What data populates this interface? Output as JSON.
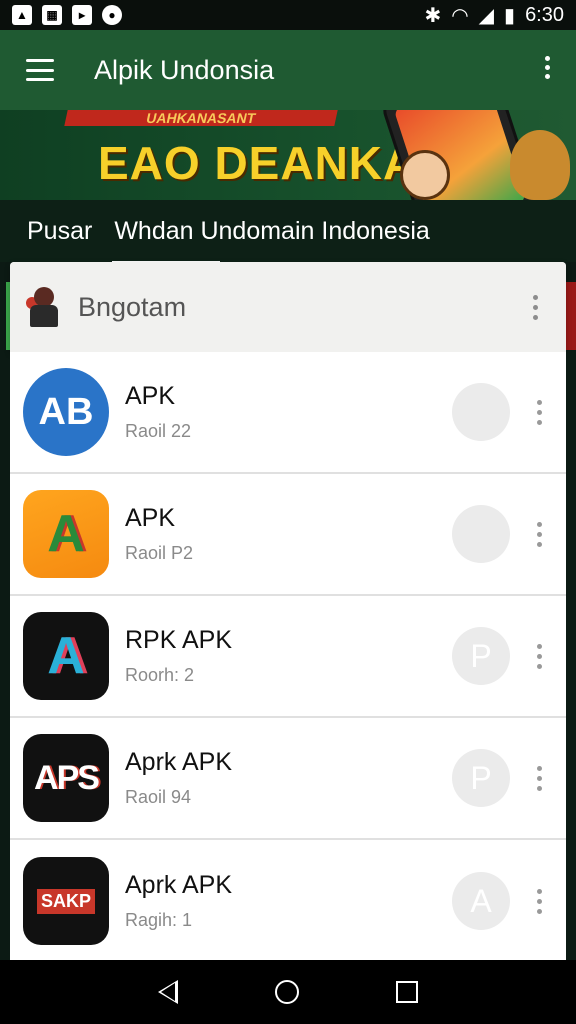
{
  "status_bar": {
    "time": "6:30",
    "left_icons": [
      "notification-icon",
      "gallery-icon",
      "play-icon",
      "circle-icon"
    ],
    "right_icons": [
      "bluetooth-icon",
      "wifi-icon",
      "signal-icon",
      "battery-icon"
    ]
  },
  "app_bar": {
    "title": "Alpik Undonsia"
  },
  "banner": {
    "ribbon_text": "UAHKANASANT",
    "headline": "EAO DEANKA"
  },
  "tabs": [
    {
      "label": "Pusar"
    },
    {
      "label": "Whdan Undomain Indonesia"
    }
  ],
  "list_header": {
    "label": "Bngotam"
  },
  "apps": [
    {
      "name": "APK",
      "sub": "Raoil 22",
      "icon_text": "AB",
      "action_glyph": ""
    },
    {
      "name": "APK",
      "sub": "Raoil P2",
      "icon_text": "A",
      "action_glyph": ""
    },
    {
      "name": "RPK APK",
      "sub": "Roorh: 2",
      "icon_text": "A",
      "action_glyph": "P"
    },
    {
      "name": "Aprk APK",
      "sub": "Raoil 94",
      "icon_text": "APS",
      "action_glyph": "P"
    },
    {
      "name": "Aprk APK",
      "sub": "Ragih: 1",
      "icon_text": "SAKP",
      "action_glyph": "A"
    }
  ],
  "colors": {
    "app_bar": "#1f5a32",
    "banner_text": "#f7d02a",
    "accent_red": "#c8372a"
  }
}
